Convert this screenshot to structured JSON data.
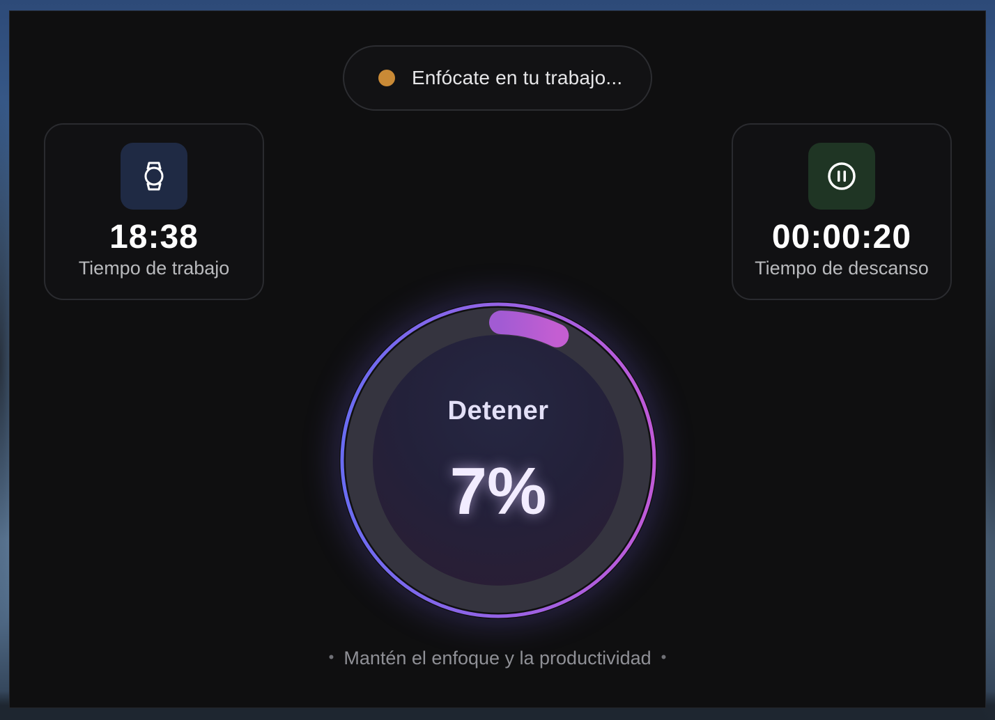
{
  "status": {
    "text": "Enfócate en tu trabajo...",
    "dot_color": "#c98a36",
    "dot_icon": "status-dot"
  },
  "work_card": {
    "icon": "watch-icon",
    "icon_bg": "#1f2a44",
    "value": "18:38",
    "label": "Tiempo de trabajo"
  },
  "break_card": {
    "icon": "pause-circle-icon",
    "icon_bg": "#1f3524",
    "value": "00:00:20",
    "label": "Tiempo de descanso"
  },
  "progress": {
    "action_label": "Detener",
    "percent_text": "7%",
    "fraction": 0.07,
    "gradient_start": "#6a6cf2",
    "gradient_end": "#c05ad8"
  },
  "footer": {
    "tip": "Mantén el enfoque y la productividad"
  }
}
